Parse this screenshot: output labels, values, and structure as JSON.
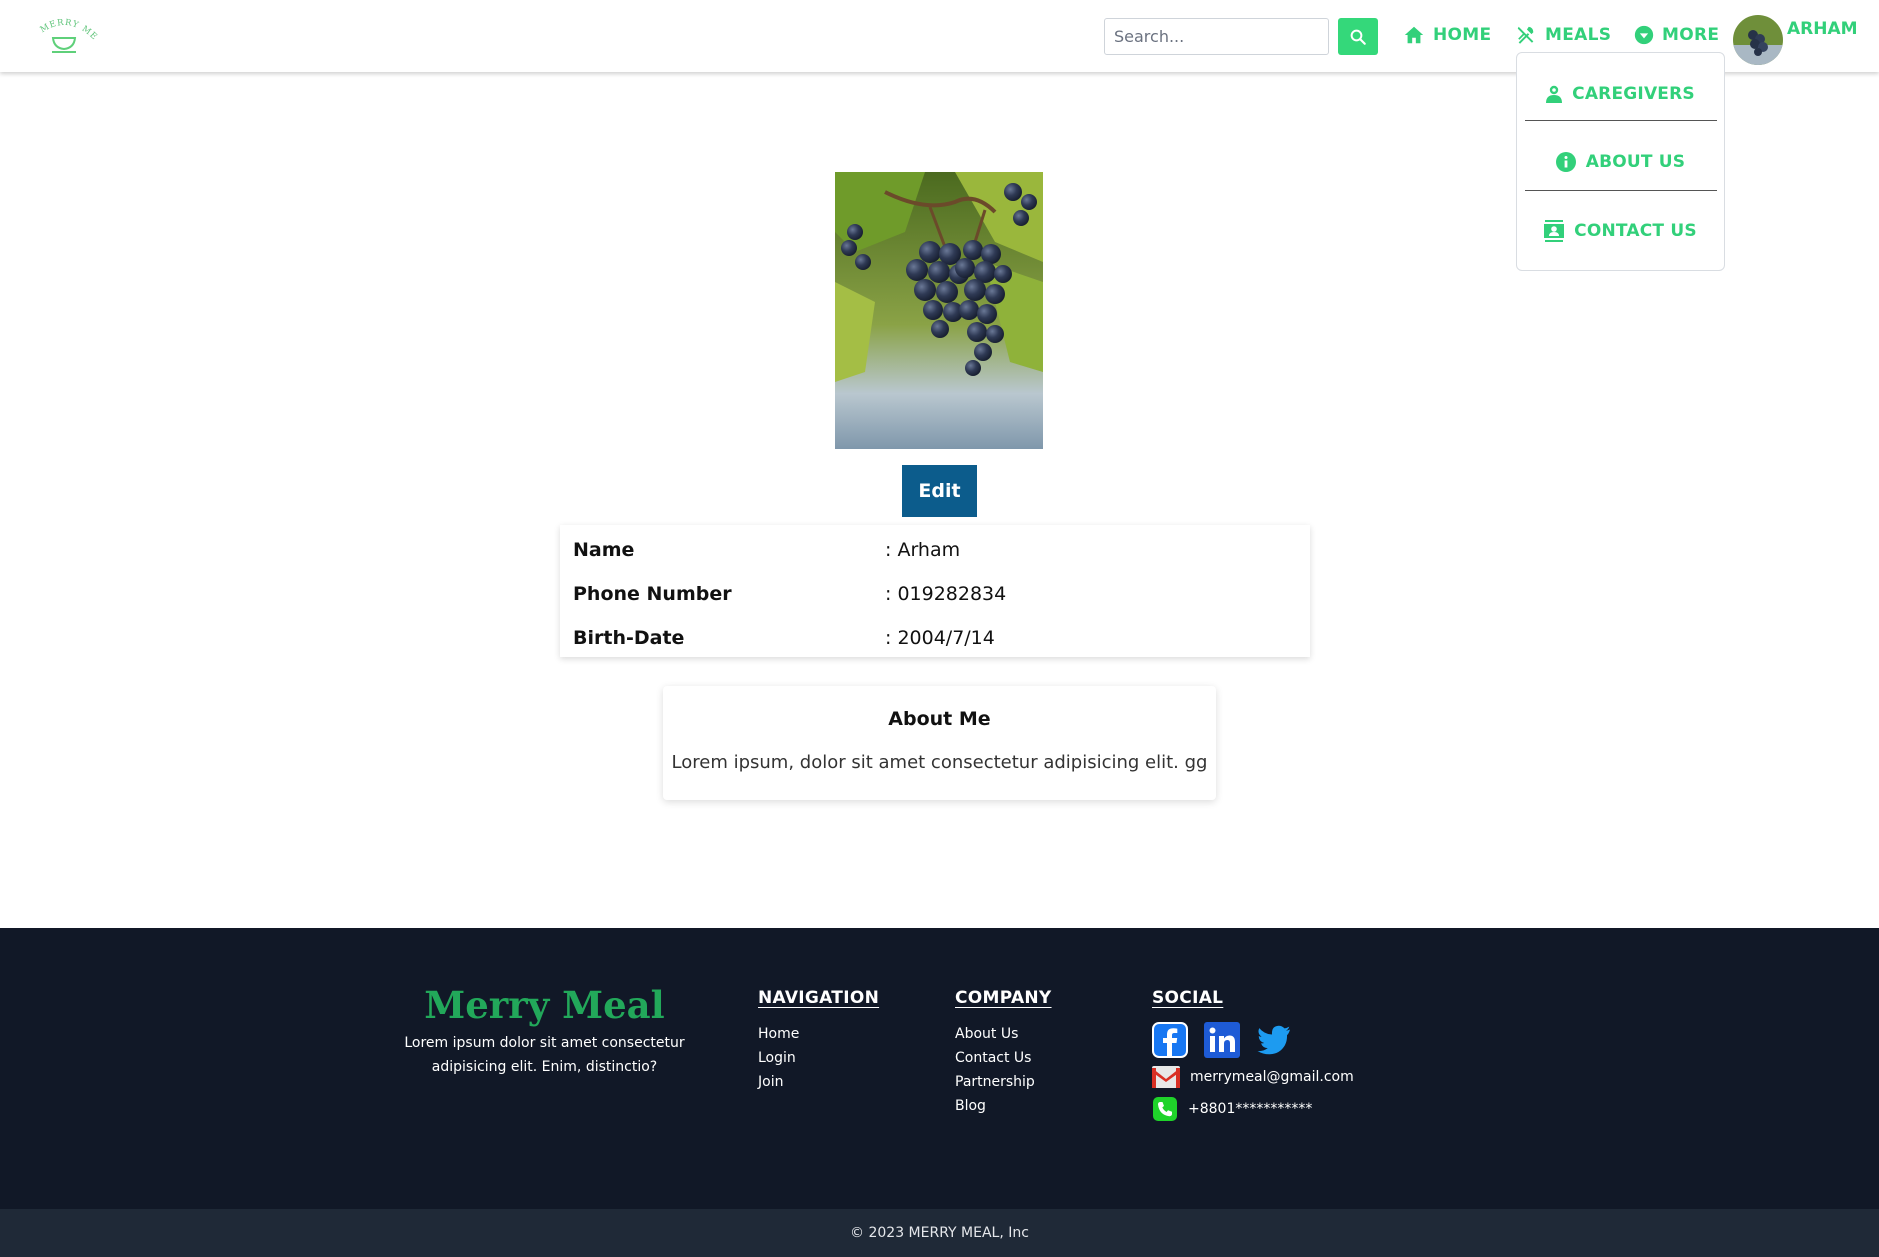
{
  "header": {
    "logo_text": "MERRY MEAL",
    "search_placeholder": "Search...",
    "nav": [
      {
        "label": "HOME",
        "icon": "home-icon"
      },
      {
        "label": "MEALS",
        "icon": "utensils-icon"
      },
      {
        "label": "MORE",
        "icon": "chevron-down-circle-icon"
      }
    ],
    "user_name": "ARHAM"
  },
  "dropdown": {
    "items": [
      {
        "label": "CAREGIVERS",
        "icon": "person-icon"
      },
      {
        "label": "ABOUT US",
        "icon": "info-icon"
      },
      {
        "label": "CONTACT US",
        "icon": "contact-card-icon"
      }
    ]
  },
  "profile": {
    "photo": "grapes-image",
    "edit_label": "Edit",
    "fields": [
      {
        "label": "Name",
        "value": ": Arham"
      },
      {
        "label": "Phone Number",
        "value": ": 019282834"
      },
      {
        "label": "Birth-Date",
        "value": ": 2004/7/14"
      }
    ],
    "about_title": "About Me",
    "about_text": "Lorem ipsum, dolor sit amet consectetur adipisicing elit. gg"
  },
  "footer": {
    "brand": "Merry Meal",
    "brand_text": "Lorem ipsum dolor sit amet consectetur adipisicing elit. Enim, distinctio?",
    "navigation": {
      "title": "NAVIGATION",
      "links": [
        "Home",
        "Login",
        "Join"
      ]
    },
    "company": {
      "title": "COMPANY",
      "links": [
        "About Us",
        "Contact Us",
        "Partnership",
        "Blog"
      ]
    },
    "social": {
      "title": "SOCIAL",
      "icons": [
        "facebook-icon",
        "linkedin-icon",
        "twitter-icon"
      ],
      "email": "merrymeal@gmail.com",
      "phone": "+8801***********"
    },
    "copyright": "© 2023 MERRY MEAL, Inc"
  },
  "colors": {
    "accent": "#32d07a",
    "edit_button": "#0c5c8c",
    "footer_bg": "#111827",
    "brand_green": "#22a85a"
  }
}
